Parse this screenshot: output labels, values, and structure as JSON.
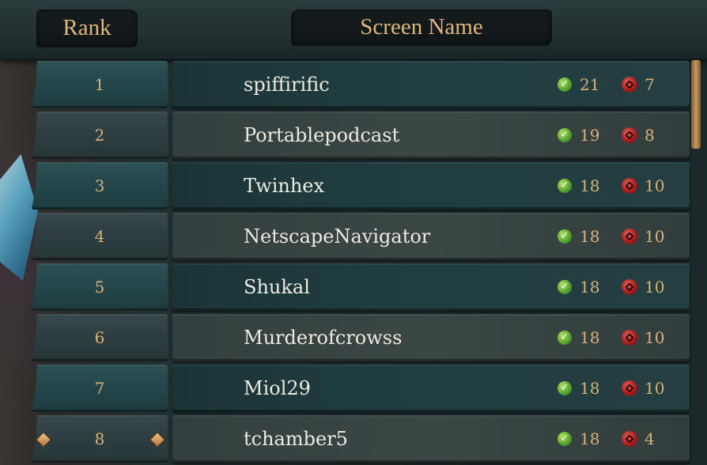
{
  "header": {
    "rank_label": "Rank",
    "screen_name_label": "Screen Name"
  },
  "rows": [
    {
      "rank": "1",
      "name": "spiffirific",
      "wins": "21",
      "losses": "7"
    },
    {
      "rank": "2",
      "name": "Portablepodcast",
      "wins": "19",
      "losses": "8"
    },
    {
      "rank": "3",
      "name": "Twinhex",
      "wins": "18",
      "losses": "10"
    },
    {
      "rank": "4",
      "name": "NetscapeNavigator",
      "wins": "18",
      "losses": "10"
    },
    {
      "rank": "5",
      "name": "Shukal",
      "wins": "18",
      "losses": "10"
    },
    {
      "rank": "6",
      "name": "Murderofcrowss",
      "wins": "18",
      "losses": "10"
    },
    {
      "rank": "7",
      "name": "Miol29",
      "wins": "18",
      "losses": "10"
    },
    {
      "rank": "8",
      "name": "tchamber5",
      "wins": "18",
      "losses": "4",
      "highlighted": true
    }
  ],
  "icons": {
    "win": "green-check-icon",
    "loss": "red-skull-icon",
    "marker": "diamond-marker-icon"
  },
  "colors": {
    "header_text": "#e0b77a",
    "name_text": "#eeeae0",
    "stat_text": "#d8b27a",
    "win": "#58a531",
    "loss": "#a91d1d"
  }
}
